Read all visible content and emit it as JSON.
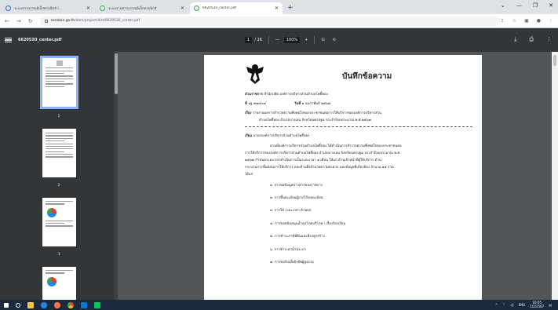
{
  "browser": {
    "tabs": [
      {
        "title": "ระบบสารบรรณอิเล็กทรอนิกส์ (...",
        "active": false
      },
      {
        "title": "ระบบงานสารบรรณอิเล็กทรอนิกส์",
        "active": false
      },
      {
        "title": "6620530_center.pdf",
        "active": true
      }
    ],
    "new_tab": "+",
    "address": {
      "host": "saraban.go.th",
      "path": "/ebm/project/dist/6620530_center.pdf"
    }
  },
  "pdf_toolbar": {
    "file_name": "6620530_center.pdf",
    "current_page": "1",
    "page_total": "/ 26",
    "zoom_out": "—",
    "zoom": "100%",
    "zoom_in": "+"
  },
  "thumbnails": [
    {
      "number": "1"
    },
    {
      "number": "2"
    },
    {
      "number": "3"
    }
  ],
  "document": {
    "title": "บันทึกข้อความ",
    "agency_label": "ส่วนราชการ",
    "agency_value": "สำนักปลัด องค์การบริหารส่วนตำบลโพธิ์ทอง",
    "ref_label": "ที่",
    "ref_value": "นฐ ๗๗๕๐๑/",
    "date_label": "วันที่",
    "date_value": "๑ กุมภาพันธ์ ๒๕๖๗",
    "subject_label": "เรื่อง",
    "subject_line1": "รายงานผลการสำรวจความพึงพอใจของประชาชนต่อการให้บริการขององค์การบริหารส่วน",
    "subject_line2": "ตำบลโพธิ์ทอง อำเภอบางเลน จังหวัดนครปฐม ประจำปีงบประมาณ พ.ศ.๒๕๖๗",
    "salutation_label": "เรียน",
    "salutation_value": "นายกองค์การบริหารส่วนตำบลโพธิ์ทอง",
    "body_line1": "ตามที่องค์การบริหารส่วนตำบลโพธิ์ทอง ได้ดำเนินการสำรวจความพึงพอใจของประชาชนต่อ",
    "body_line2": "การให้บริการขององค์การบริหารส่วนตำบลโพธิ์ทอง อำเภอบางเลน จังหวัดนครปฐม ประจำปีงบประมาณ พ.ศ.",
    "body_line3": "๒๕๖๗ กำหนดระยะเวลาดำเนินการเป็นระยะเวลา ๑ เดือน ให้แก่ ด้านเจ้าหน้าที่ผู้ให้บริการ ด้าน",
    "body_line4": "กระบวนการขั้นตอนการให้บริการ และด้านสิ่งอำนวยความสะดวก และข้อมูลที่เกี่ยวข้อง จำนวน ๑๔ งาน",
    "body_line5": "ได้แก่",
    "items": [
      "๑. การขอข้อมูลข่าวสารของราชการ",
      "๒. การขึ้นทะเบียนผู้ยากไร้ลงทะเบียน",
      "๓. การให้ ระยะเวลา ด้านบล",
      "๔. การขอสนับสนุนน้ำอุปโภคบริโภค / เรื่องร้องเรียน",
      "๕. การชำระภาษีที่ดินและสิ่งปลูกสร้าง",
      "๖. การชำระค่าน้ำประปา",
      "๗. การขอรับเบี้ยยังชีพผู้สูงอายุ"
    ]
  },
  "taskbar": {
    "lang": "ENG",
    "time": "10:05",
    "date": "1/2/2567"
  },
  "colors": {
    "toolbar_bg": "#323639",
    "viewer_bg": "#525659",
    "active_thumb": "#8ab4f8",
    "taskbar_bg": "#1b2b3d"
  }
}
